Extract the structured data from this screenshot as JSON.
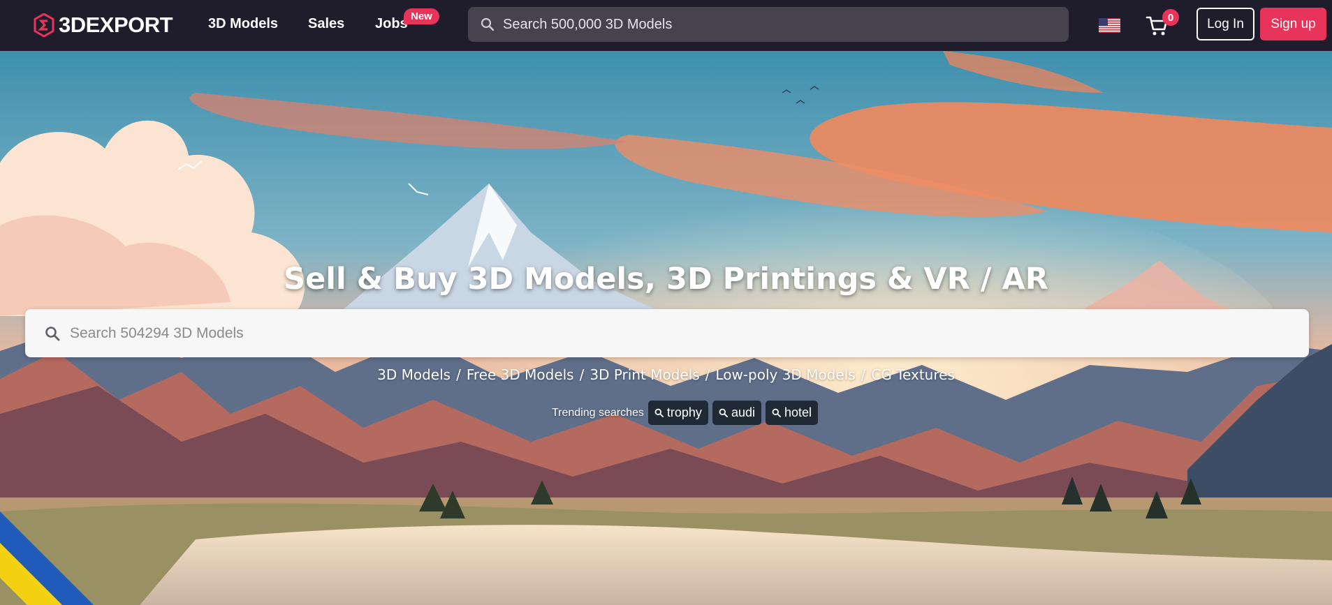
{
  "brand": {
    "name": "3DEXPORT"
  },
  "nav": {
    "links": [
      {
        "label": "3D Models"
      },
      {
        "label": "Sales"
      },
      {
        "label": "Jobs"
      }
    ],
    "jobs_badge": "New",
    "search_placeholder": "Search 500,000 3D Models",
    "cart_count": "0",
    "login_label": "Log In",
    "signup_label": "Sign up"
  },
  "hero": {
    "title": "Sell & Buy 3D Models, 3D Printings & VR / AR",
    "search_placeholder": "Search 504294 3D Models",
    "categories": [
      "3D Models",
      "Free 3D Models",
      "3D Print Models",
      "Low-poly 3D Models",
      "CG Textures"
    ],
    "category_separator": "/",
    "trending_label": "Trending searches",
    "trending": [
      "trophy",
      "audi",
      "hotel"
    ]
  },
  "colors": {
    "accent": "#e8335a",
    "nav_bg": "#1f1d2c",
    "tag_bg": "#1f2a36"
  },
  "icons": [
    "logo-icon",
    "search-icon",
    "us-flag-icon",
    "cart-icon",
    "ukraine-ribbon"
  ]
}
